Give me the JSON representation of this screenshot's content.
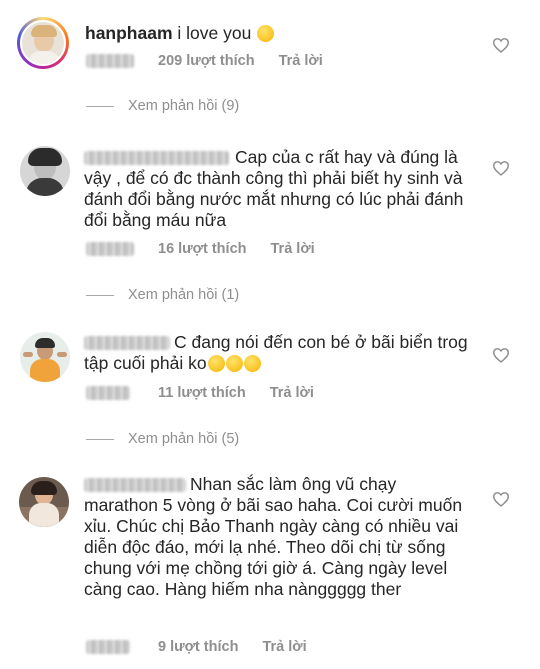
{
  "comments": [
    {
      "username": "hanphaam",
      "text": "i love you",
      "emoji": "😯",
      "likes": "209 lượt thích",
      "reply": "Trả lời",
      "view_replies": "Xem phản hồi (9)"
    },
    {
      "text": "Cap của c rất hay và đúng là vậy , để có đc thành công thì phải biết hy sinh và đánh đổi bằng nước mắt nhưng có lúc phải đánh đổi bằng máu nữa",
      "likes": "16 lượt thích",
      "reply": "Trả lời",
      "view_replies": "Xem phản hồi (1)"
    },
    {
      "text": "C đang nói đến con bé ở bãi biển trog tập cuối phải ko",
      "emoji": "🤔🤔🤔",
      "likes": "11 lượt thích",
      "reply": "Trả lời",
      "view_replies": "Xem phản hồi (5)"
    },
    {
      "text": "Nhan sắc làm ông vũ chạy marathon 5 vòng ở bãi sao haha. Coi cười muốn xỉu. Chúc chị Bảo Thanh ngày càng có nhiều vai diễn độc đáo, mới lạ nhé. Theo dõi chị từ sống chung với mẹ chồng tới giờ á. Càng ngày level càng cao. Hàng hiếm nha nànggggg ther",
      "likes": "9 lượt thích",
      "reply": "Trả lời"
    }
  ],
  "colors": {
    "text": "#262626",
    "meta": "#8e8e8e"
  },
  "icons": {
    "like": "heart-icon"
  }
}
